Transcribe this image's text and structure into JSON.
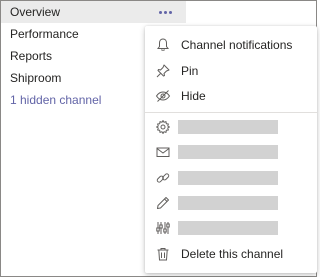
{
  "channels": [
    {
      "label": "Overview",
      "selected": true
    },
    {
      "label": "Performance"
    },
    {
      "label": "Reports"
    },
    {
      "label": "Shiproom"
    }
  ],
  "hidden_channels_label": "1 hidden channel",
  "menu": {
    "items": [
      {
        "icon": "bell-icon",
        "label": "Channel notifications"
      },
      {
        "icon": "pin-icon",
        "label": "Pin"
      },
      {
        "icon": "hide-icon",
        "label": "Hide"
      }
    ],
    "placeholder_items": [
      {
        "icon": "gear-icon"
      },
      {
        "icon": "mail-icon"
      },
      {
        "icon": "link-icon"
      },
      {
        "icon": "pencil-icon"
      },
      {
        "icon": "connectors-icon"
      }
    ],
    "delete_label": "Delete this channel"
  },
  "colors": {
    "accent": "#6264a7",
    "selected_bg": "#ebebeb",
    "placeholder": "#d2d2d2",
    "text": "#252423"
  }
}
